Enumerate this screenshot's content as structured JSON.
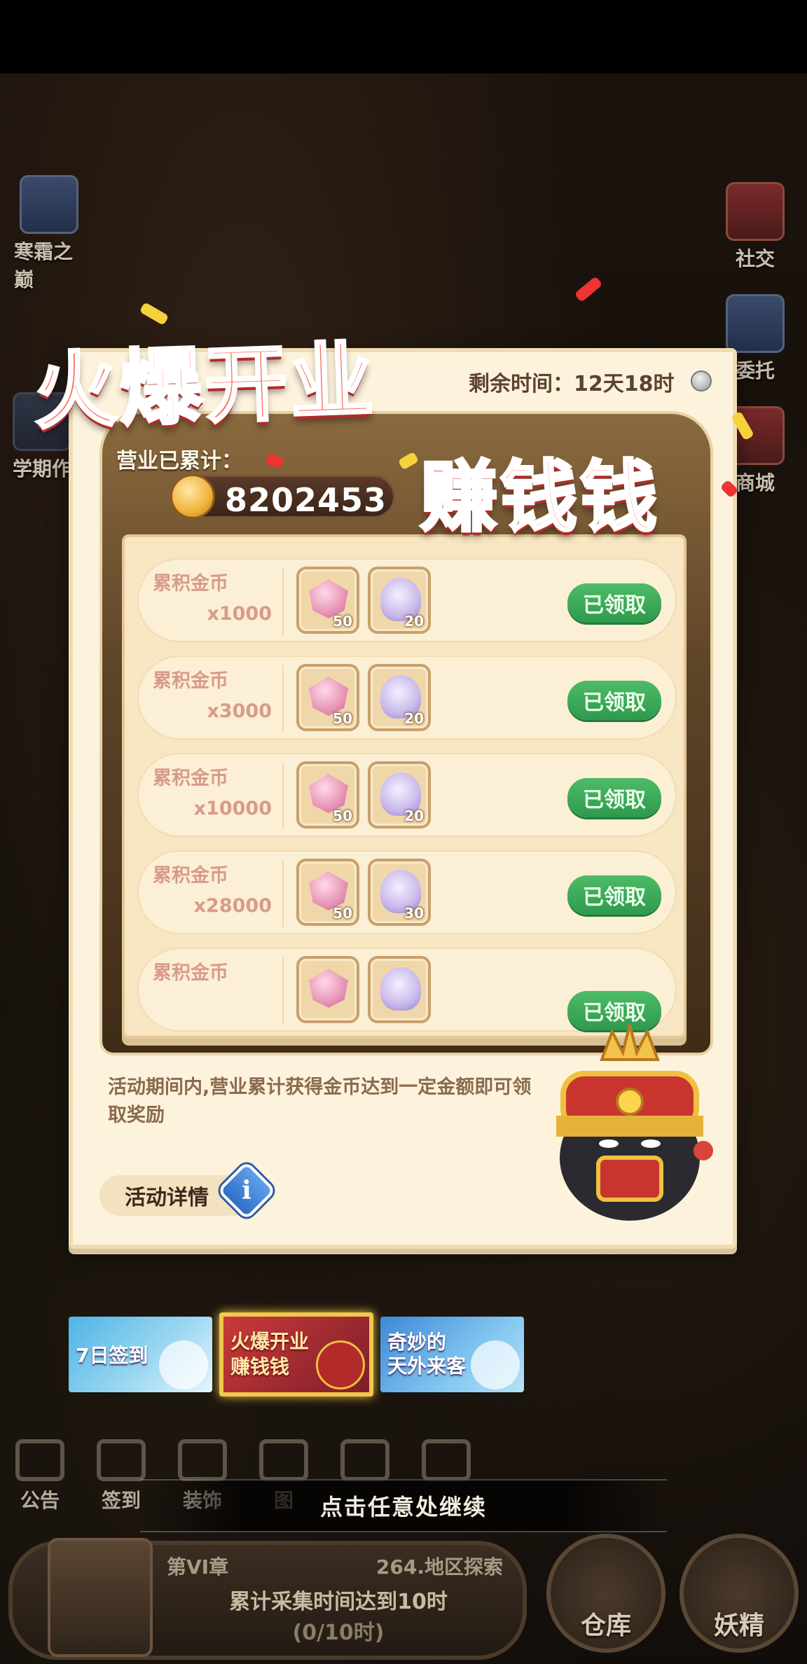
{
  "side_buttons": [
    {
      "label": "寒霜之巅"
    },
    {
      "label": "学期作"
    },
    {
      "label": "社交"
    },
    {
      "label": "委托"
    },
    {
      "label": "商城"
    }
  ],
  "event": {
    "title_top": "火爆开业",
    "title_bottom": "赚钱钱",
    "countdown": "剩余时间：12天18时",
    "accumulated_label": "营业已累计：",
    "accumulated_value": "8202453",
    "rewards": [
      {
        "label": "累积金币",
        "amount": "x1000",
        "gem_qty": "50",
        "ghost_qty": "20",
        "status": "已领取"
      },
      {
        "label": "累积金币",
        "amount": "x3000",
        "gem_qty": "50",
        "ghost_qty": "20",
        "status": "已领取"
      },
      {
        "label": "累积金币",
        "amount": "x10000",
        "gem_qty": "50",
        "ghost_qty": "20",
        "status": "已领取"
      },
      {
        "label": "累积金币",
        "amount": "x28000",
        "gem_qty": "50",
        "ghost_qty": "30",
        "status": "已领取"
      },
      {
        "label": "累积金币",
        "amount": "",
        "gem_qty": "",
        "ghost_qty": "",
        "status": "已领取"
      }
    ],
    "description": "活动期间内,营业累计获得金币达到一定金额即可领取奖励",
    "details_label": "活动详情",
    "info_glyph": "i"
  },
  "event_tabs": [
    {
      "label": "7日签到"
    },
    {
      "label_line1": "火爆开业",
      "label_line2": "赚钱钱"
    },
    {
      "label_line1": "奇妙的",
      "label_line2": "天外来客"
    }
  ],
  "bottom_nav": [
    {
      "label": "公告"
    },
    {
      "label": "签到"
    },
    {
      "label": "装饰"
    },
    {
      "label": "图"
    },
    {
      "label": ""
    },
    {
      "label": ""
    }
  ],
  "continue_hint": "点击任意处继续",
  "chapter": {
    "chapter_label": "第VI章",
    "region_label": "264.地区探索",
    "task": "累计采集时间达到10时",
    "progress": "(0/10时)"
  },
  "right_buttons": [
    {
      "label": "仓库"
    },
    {
      "label": "妖精"
    }
  ],
  "colors": {
    "title_red": "#ff6b5b",
    "claimed_green": "#3aa957",
    "panel_cream": "#fdf3dc",
    "tab_highlight": "#f1c84a"
  }
}
